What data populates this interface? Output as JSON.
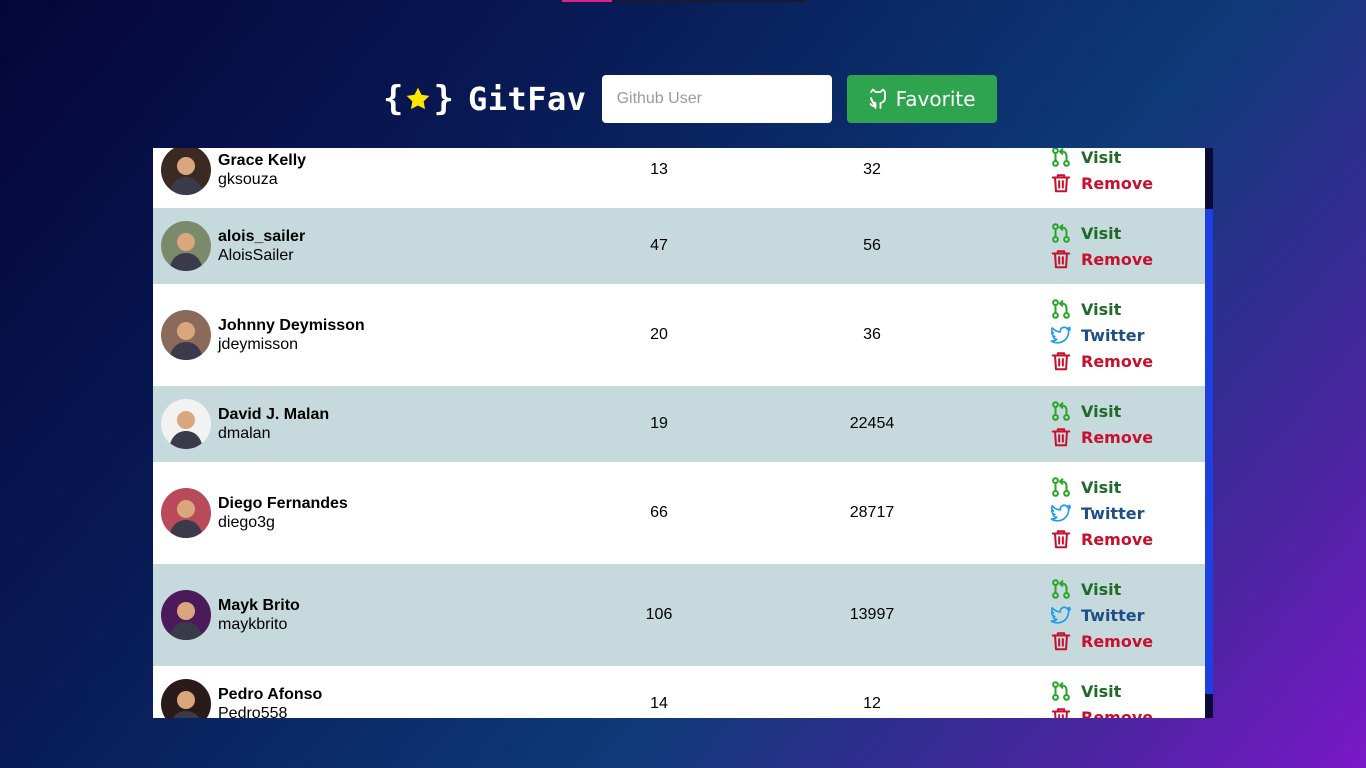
{
  "app": {
    "logo_left_brace": "{",
    "logo_right_brace": "}",
    "name": "GitFav",
    "search_placeholder": "Github User",
    "favorite_label": "Favorite"
  },
  "actions": {
    "visit": "Visit",
    "twitter": "Twitter",
    "remove": "Remove"
  },
  "colors": {
    "favorite_button": "#2ea44f",
    "row_alt": "#c6dade",
    "visit": "#1f6b2a",
    "twitter": "#1f4e87",
    "remove": "#c8102e",
    "scrollbar_thumb": "#1c41e0"
  },
  "users": [
    {
      "name": "Grace Kelly",
      "login": "gksouza",
      "repos": "13",
      "followers": "32",
      "twitter": false,
      "avatar_color": "#3a2a22"
    },
    {
      "name": "alois_sailer",
      "login": "AloisSailer",
      "repos": "47",
      "followers": "56",
      "twitter": false,
      "avatar_color": "#7a8a6a"
    },
    {
      "name": "Johnny Deymisson",
      "login": "jdeymisson",
      "repos": "20",
      "followers": "36",
      "twitter": true,
      "avatar_color": "#8a6a5a"
    },
    {
      "name": "David J. Malan",
      "login": "dmalan",
      "repos": "19",
      "followers": "22454",
      "twitter": false,
      "avatar_color": "#f2f2f2"
    },
    {
      "name": "Diego Fernandes",
      "login": "diego3g",
      "repos": "66",
      "followers": "28717",
      "twitter": true,
      "avatar_color": "#b84a5a"
    },
    {
      "name": "Mayk Brito",
      "login": "maykbrito",
      "repos": "106",
      "followers": "13997",
      "twitter": true,
      "avatar_color": "#4a1a5a"
    },
    {
      "name": "Pedro Afonso",
      "login": "Pedro558",
      "repos": "14",
      "followers": "12",
      "twitter": false,
      "avatar_color": "#2a1a1a"
    }
  ]
}
